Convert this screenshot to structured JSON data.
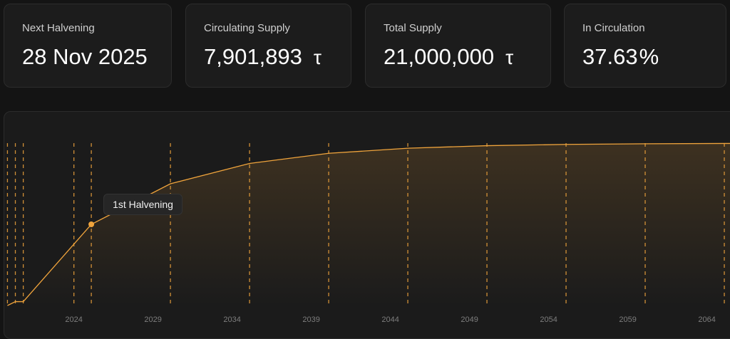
{
  "stats": {
    "next_halvening": {
      "label": "Next Halvening",
      "value": "28 Nov 2025"
    },
    "circulating_supply": {
      "label": "Circulating Supply",
      "value": "7,901,893",
      "unit": "τ"
    },
    "total_supply": {
      "label": "Total Supply",
      "value": "21,000,000",
      "unit": "τ"
    },
    "in_circulation": {
      "label": "In Circulation",
      "value": "37.63",
      "unit": "%"
    }
  },
  "tooltip": {
    "label": "1st Halvening"
  },
  "colors": {
    "accent": "#f0a43c",
    "background": "#141414",
    "card": "#1c1c1c"
  },
  "chart_data": {
    "type": "area",
    "xlabel": "",
    "ylabel": "",
    "x_ticks": [
      "2024",
      "2029",
      "2034",
      "2039",
      "2044",
      "2049",
      "2054",
      "2059",
      "2064"
    ],
    "x_tick_values": [
      2024,
      2029,
      2034,
      2039,
      2044,
      2049,
      2054,
      2059,
      2064
    ],
    "xlim": [
      2019.6,
      2066
    ],
    "ylim": [
      0,
      21000000
    ],
    "grid": "vertical dashed lines at halvenings",
    "series": [
      {
        "x": [
          2019.8,
          2020.3,
          2020.8,
          2025.1,
          2030.1,
          2035.1,
          2040.1,
          2045.1,
          2050.1,
          2055.1,
          2060.1,
          2065.1,
          2066
        ],
        "y": [
          0,
          500000,
          500000,
          10500000,
          15750000,
          18375000,
          19687500,
          20343750,
          20671875,
          20835937,
          20917969,
          20958984,
          20960000
        ]
      }
    ],
    "highlight_point": {
      "x": 2025.1,
      "y": 10500000,
      "label": "1st Halvening"
    },
    "vertical_markers": [
      2019.8,
      2020.3,
      2020.8,
      2024.0,
      2025.1,
      2030.1,
      2035.1,
      2040.1,
      2045.1,
      2050.1,
      2055.1,
      2060.1,
      2065.1
    ]
  }
}
